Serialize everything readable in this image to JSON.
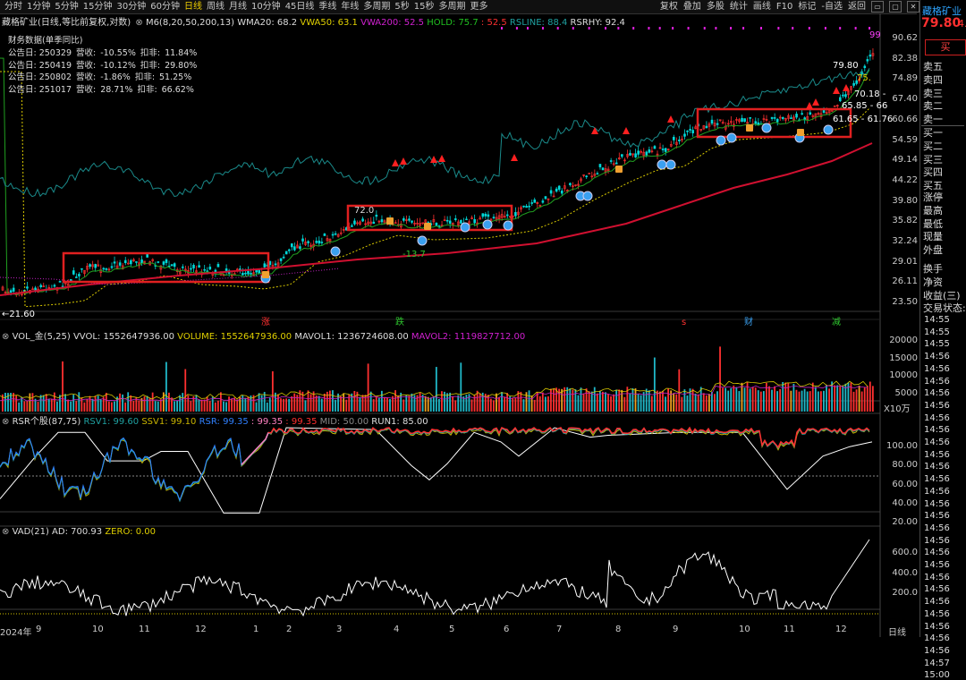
{
  "toolbar": {
    "periods": [
      "分时",
      "1分钟",
      "5分钟",
      "15分钟",
      "30分钟",
      "60分钟",
      "日线",
      "周线",
      "月线",
      "10分钟",
      "45日线",
      "季线",
      "年线",
      "多周期",
      "5秒",
      "15秒",
      "多周期",
      "更多"
    ],
    "active_period": "日线",
    "right_items": [
      "复权",
      "叠加",
      "多股",
      "统计",
      "画线",
      "F10",
      "标记",
      "-自选",
      "返回"
    ]
  },
  "main_chart": {
    "title": "藏格矿业(日线,等比前复权,对数)",
    "indicator": "M6(8,20,50,200,13)",
    "wma20": "WMA20: 68.2",
    "vwa50": "VWA50: 63.1",
    "vwa200": "VWA200: 52.5",
    "hold": "HOLD: 75.7",
    "hold2": ": 52.5",
    "rsline": "RSLINE: 88.4",
    "rsrhy": "RSRHY: 92.4",
    "price_axis": [
      "90.62",
      "82.38",
      "74.89",
      "67.40",
      "60.66",
      "54.59",
      "49.14",
      "44.22",
      "39.80",
      "35.82",
      "32.24",
      "29.01",
      "26.11",
      "23.50"
    ],
    "annotations": {
      "high": "79.80",
      "low": "21.60",
      "mid_low": "-13.7",
      "box2_high": "72.0",
      "right_a": "75.",
      "right_b": "70.18 -",
      "right_c": "65.85 - 66",
      "right_d": "61.65 - 61.76",
      "right_top": "99"
    },
    "event_markers": [
      "涨",
      "跌",
      "s",
      "财",
      "减"
    ],
    "colors": {
      "up": "#ff3030",
      "down": "#00ffff",
      "wma": "#20a020",
      "vwa50": "#d8c800",
      "vwa200": "#d01030",
      "rs": "#1a8a8a"
    }
  },
  "financial": {
    "title": "财务数据(单季同比)",
    "rows": [
      {
        "date": "公告日: 250329",
        "rev_label": "营收:",
        "rev": "-10.55%",
        "np_label": "扣非:",
        "np": "11.84%"
      },
      {
        "date": "公告日: 250419",
        "rev_label": "营收:",
        "rev": "-10.12%",
        "np_label": "扣非:",
        "np": "29.80%"
      },
      {
        "date": "公告日: 250802",
        "rev_label": "营收:",
        "rev": "-1.86%",
        "np_label": "扣非:",
        "np": "51.25%"
      },
      {
        "date": "公告日: 251017",
        "rev_label": "营收:",
        "rev": "28.71%",
        "np_label": "扣非:",
        "np": "66.62%"
      }
    ]
  },
  "volume": {
    "title": "VOL_金(5,25)",
    "vvol": "VVOL: 1552647936.00",
    "volume": "VOLUME: 1552647936.00",
    "mavol1": "MAVOL1: 1236724608.00",
    "mavol2": "MAVOL2: 1119827712.00",
    "axis": [
      "20000",
      "15000",
      "10000",
      "5000"
    ],
    "unit": "X10万"
  },
  "rsr": {
    "title": "RSR个股(87,75)",
    "rsv1": "RSV1: 99.60",
    "ssv1": "SSV1: 99.10",
    "rsr": "RSR: 99.35",
    "a": ": 99.35",
    "b": ": 99.35",
    "mid": "MID: 50.00",
    "run1": "RUN1: 85.00",
    "axis": [
      "100.00",
      "80.00",
      "60.00",
      "40.00",
      "20.00"
    ]
  },
  "vad": {
    "title": "VAD(21)",
    "ad": "AD: 700.93",
    "zero": "ZERO: 0.00",
    "axis": [
      "600.0",
      "400.0",
      "200.0"
    ]
  },
  "xaxis": {
    "year": "2024年",
    "months": [
      "9",
      "10",
      "11",
      "12",
      "1",
      "2",
      "3",
      "4",
      "5",
      "6",
      "7",
      "8",
      "9",
      "10",
      "11",
      "12"
    ],
    "period": "日线"
  },
  "side_panel": {
    "name": "藏格矿业",
    "price": "79.80",
    "change": "4.",
    "buy": "买",
    "orderbook": [
      "卖五",
      "卖四",
      "卖三",
      "卖二",
      "卖一",
      "买一",
      "买二",
      "买三",
      "买四",
      "买五"
    ],
    "quote_labels": [
      "涨停",
      "最高",
      "最低",
      "现量",
      "外盘",
      "换手",
      "净资",
      "收益(三)"
    ],
    "trade_status": "交易状态:",
    "ticks": [
      "14:55",
      "14:55",
      "14:55",
      "14:56",
      "14:56",
      "14:56",
      "14:56",
      "14:56",
      "14:56",
      "14:56",
      "14:56",
      "14:56",
      "14:56",
      "14:56",
      "14:56",
      "14:56",
      "14:56",
      "14:56",
      "14:56",
      "14:56",
      "14:56",
      "14:56",
      "14:56",
      "14:56",
      "14:56",
      "14:56",
      "14:56",
      "14:56",
      "14:57",
      "15:00"
    ]
  }
}
